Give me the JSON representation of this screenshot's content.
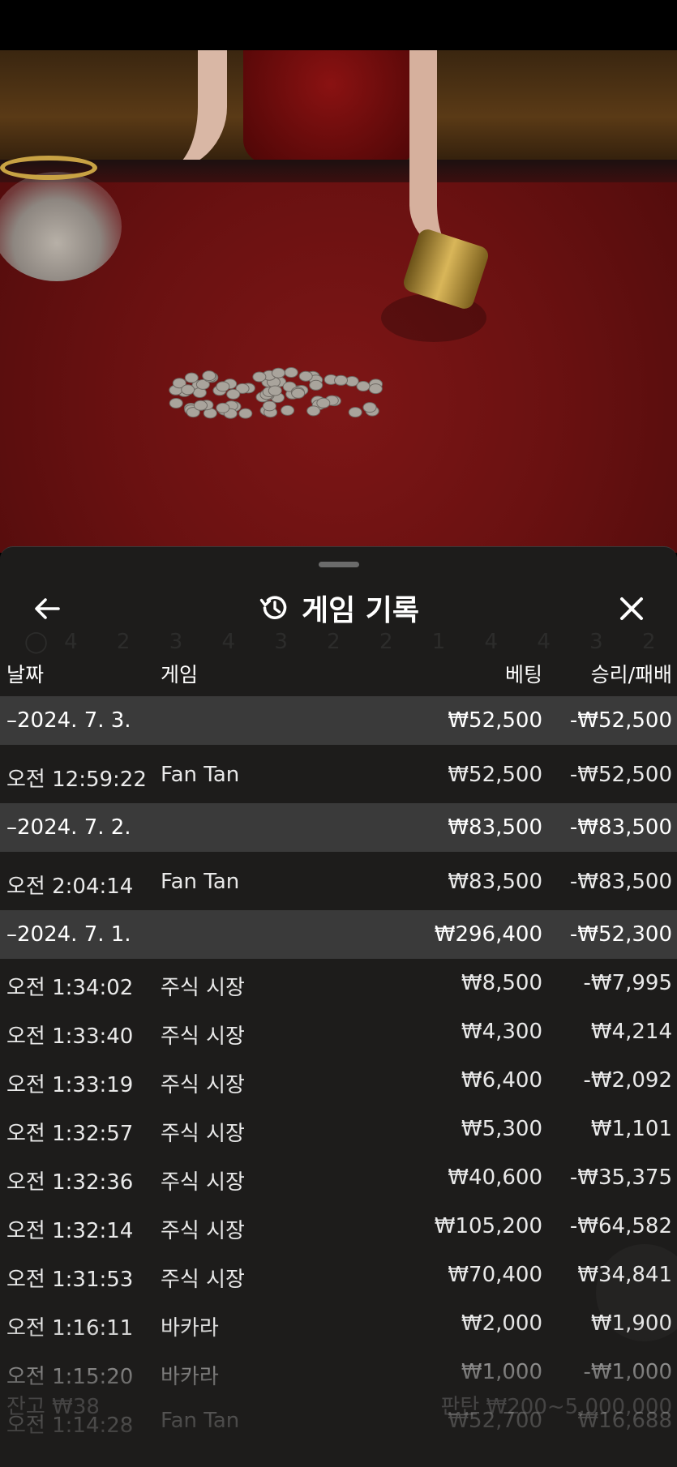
{
  "header": {
    "title": "게임 기록",
    "back_icon": "arrow-left-icon",
    "history_icon": "history-icon",
    "close_icon": "close-icon"
  },
  "columns": {
    "date": "날짜",
    "game": "게임",
    "bet": "베팅",
    "win_loss": "승리/패배"
  },
  "groups": [
    {
      "date": "–2024. 7. 3.",
      "bet": "₩52,500",
      "result": "-₩52,500",
      "items": [
        {
          "time": "오전 12:59:22",
          "game": "Fan Tan",
          "bet": "₩52,500",
          "result": "-₩52,500"
        }
      ]
    },
    {
      "date": "–2024. 7. 2.",
      "bet": "₩83,500",
      "result": "-₩83,500",
      "items": [
        {
          "time": "오전 2:04:14",
          "game": "Fan Tan",
          "bet": "₩83,500",
          "result": "-₩83,500"
        }
      ]
    },
    {
      "date": "–2024. 7. 1.",
      "bet": "₩296,400",
      "result": "-₩52,300",
      "items": [
        {
          "time": "오전 1:34:02",
          "game": "주식 시장",
          "bet": "₩8,500",
          "result": "-₩7,995"
        },
        {
          "time": "오전 1:33:40",
          "game": "주식 시장",
          "bet": "₩4,300",
          "result": "₩4,214"
        },
        {
          "time": "오전 1:33:19",
          "game": "주식 시장",
          "bet": "₩6,400",
          "result": "-₩2,092"
        },
        {
          "time": "오전 1:32:57",
          "game": "주식 시장",
          "bet": "₩5,300",
          "result": "₩1,101"
        },
        {
          "time": "오전 1:32:36",
          "game": "주식 시장",
          "bet": "₩40,600",
          "result": "-₩35,375"
        },
        {
          "time": "오전 1:32:14",
          "game": "주식 시장",
          "bet": "₩105,200",
          "result": "-₩64,582"
        },
        {
          "time": "오전 1:31:53",
          "game": "주식 시장",
          "bet": "₩70,400",
          "result": "₩34,841"
        },
        {
          "time": "오전 1:16:11",
          "game": "바카라",
          "bet": "₩2,000",
          "result": "₩1,900"
        },
        {
          "time": "오전 1:15:20",
          "game": "바카라",
          "bet": "₩1,000",
          "result": "-₩1,000"
        },
        {
          "time": "오전 1:14:28",
          "game": "Fan Tan",
          "bet": "₩52,700",
          "result": "₩16,688"
        }
      ]
    }
  ],
  "overlay": {
    "balance_text": "잔고 ₩38",
    "limit_text": "판탄 ₩200~5,000,000"
  },
  "colors": {
    "sheet_bg": "#1d1c1b",
    "group_row_bg": "#3a3a3a",
    "table_felt": "#6a1111"
  }
}
